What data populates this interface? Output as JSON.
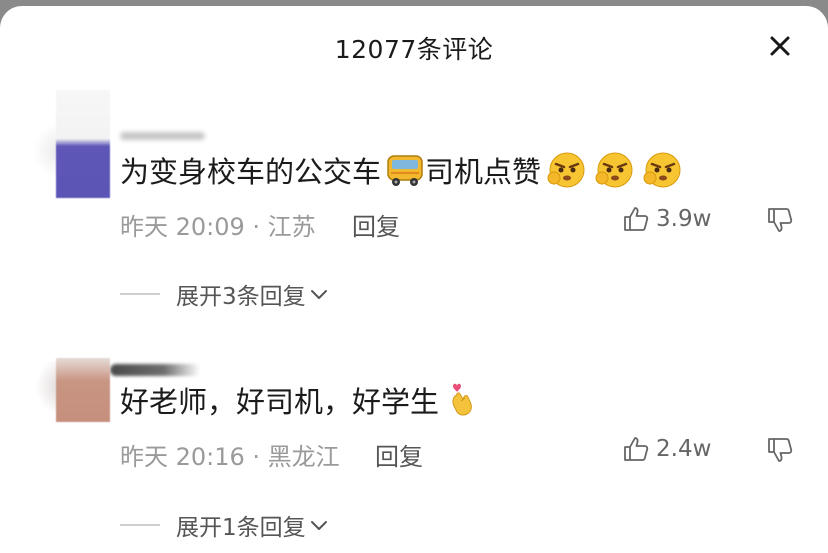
{
  "header": {
    "title": "12077条评论"
  },
  "comments": [
    {
      "text": "为变身校车的公交车",
      "text_after": "司机点赞",
      "emojis": [
        "bus-emoji",
        "angry-emoji",
        "angry-emoji",
        "angry-emoji"
      ],
      "meta": "昨天 20:09 · 江苏",
      "reply_label": "回复",
      "likes": "3.9w",
      "expand_label": "展开3条回复"
    },
    {
      "text": "好老师，好司机，好学生",
      "text_after": "",
      "emojis": [
        "finger-heart-emoji"
      ],
      "meta": "昨天 20:16 · 黑龙江",
      "reply_label": "回复",
      "likes": "2.4w",
      "expand_label": "展开1条回复"
    }
  ],
  "colors": {
    "text": "#1b1b1b",
    "meta": "#9a9a9a",
    "icon": "#666666"
  }
}
